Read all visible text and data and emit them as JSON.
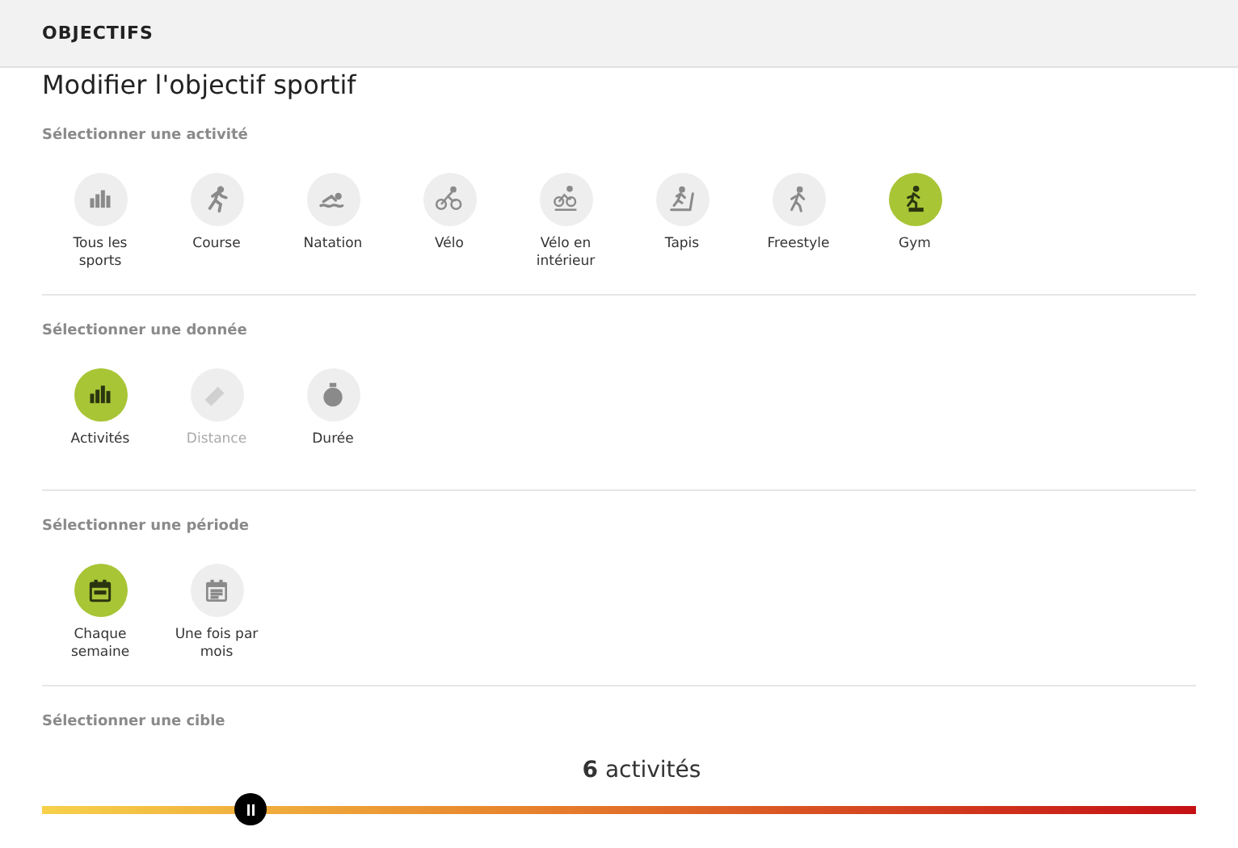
{
  "header": {
    "title": "OBJECTIFS"
  },
  "page_title": "Modifier l'objectif sportif",
  "sections": [
    {
      "label": "Sélectionner une activité",
      "options": [
        {
          "label": "Tous les sports",
          "kind": "bars",
          "selected": false,
          "disabled": false
        },
        {
          "label": "Course",
          "kind": "run",
          "selected": false,
          "disabled": false
        },
        {
          "label": "Natation",
          "kind": "swim",
          "selected": false,
          "disabled": false
        },
        {
          "label": "Vélo",
          "kind": "bike",
          "selected": false,
          "disabled": false
        },
        {
          "label": "Vélo en intérieur",
          "kind": "indoor-bike",
          "selected": false,
          "disabled": false
        },
        {
          "label": "Tapis",
          "kind": "treadmill",
          "selected": false,
          "disabled": false
        },
        {
          "label": "Freestyle",
          "kind": "walk",
          "selected": false,
          "disabled": false
        },
        {
          "label": "Gym",
          "kind": "gym",
          "selected": true,
          "disabled": false
        }
      ]
    },
    {
      "label": "Sélectionner une donnée",
      "options": [
        {
          "label": "Activités",
          "kind": "bars",
          "selected": true,
          "disabled": false
        },
        {
          "label": "Distance",
          "kind": "ruler",
          "selected": false,
          "disabled": true
        },
        {
          "label": "Durée",
          "kind": "stopwatch",
          "selected": false,
          "disabled": false
        }
      ]
    },
    {
      "label": "Sélectionner une période",
      "options": [
        {
          "label": "Chaque semaine",
          "kind": "calendar",
          "selected": true,
          "disabled": false
        },
        {
          "label": "Une fois par mois",
          "kind": "calendar-month",
          "selected": false,
          "disabled": false
        }
      ]
    }
  ],
  "target": {
    "label": "Sélectionner une cible",
    "value": "**6** activités",
    "level": 0.18
  }
}
